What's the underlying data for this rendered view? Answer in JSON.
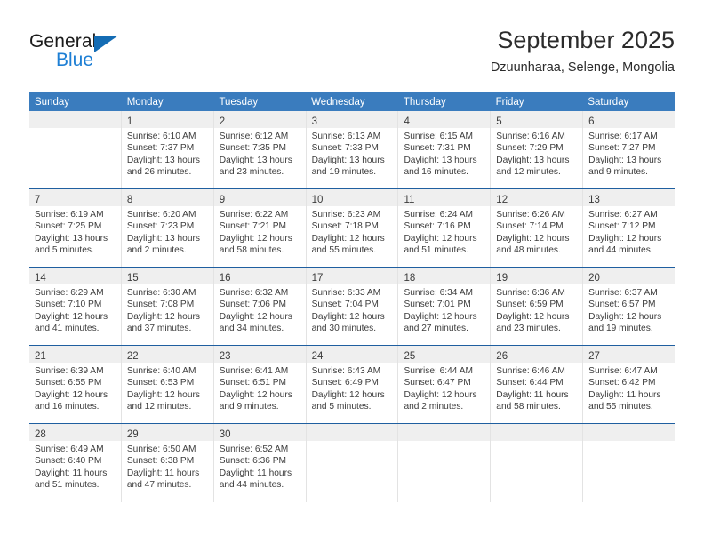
{
  "brand": {
    "name_top": "General",
    "name_bottom": "Blue",
    "triangle_color": "#146cb4",
    "blue_text_color": "#1e7fd4"
  },
  "header": {
    "title": "September 2025",
    "subtitle": "Dzuunharaa, Selenge, Mongolia"
  },
  "theme": {
    "header_bar_color": "#3a7cbe",
    "week_divider_color": "#1f5fa0",
    "daynum_band_color": "#efefef",
    "text_color": "#3c3c3c"
  },
  "weekdays": [
    "Sunday",
    "Monday",
    "Tuesday",
    "Wednesday",
    "Thursday",
    "Friday",
    "Saturday"
  ],
  "weeks": [
    [
      {
        "day": "",
        "sunrise": "",
        "sunset": "",
        "daylight_line1": "",
        "daylight_line2": ""
      },
      {
        "day": "1",
        "sunrise": "Sunrise: 6:10 AM",
        "sunset": "Sunset: 7:37 PM",
        "daylight_line1": "Daylight: 13 hours",
        "daylight_line2": "and 26 minutes."
      },
      {
        "day": "2",
        "sunrise": "Sunrise: 6:12 AM",
        "sunset": "Sunset: 7:35 PM",
        "daylight_line1": "Daylight: 13 hours",
        "daylight_line2": "and 23 minutes."
      },
      {
        "day": "3",
        "sunrise": "Sunrise: 6:13 AM",
        "sunset": "Sunset: 7:33 PM",
        "daylight_line1": "Daylight: 13 hours",
        "daylight_line2": "and 19 minutes."
      },
      {
        "day": "4",
        "sunrise": "Sunrise: 6:15 AM",
        "sunset": "Sunset: 7:31 PM",
        "daylight_line1": "Daylight: 13 hours",
        "daylight_line2": "and 16 minutes."
      },
      {
        "day": "5",
        "sunrise": "Sunrise: 6:16 AM",
        "sunset": "Sunset: 7:29 PM",
        "daylight_line1": "Daylight: 13 hours",
        "daylight_line2": "and 12 minutes."
      },
      {
        "day": "6",
        "sunrise": "Sunrise: 6:17 AM",
        "sunset": "Sunset: 7:27 PM",
        "daylight_line1": "Daylight: 13 hours",
        "daylight_line2": "and 9 minutes."
      }
    ],
    [
      {
        "day": "7",
        "sunrise": "Sunrise: 6:19 AM",
        "sunset": "Sunset: 7:25 PM",
        "daylight_line1": "Daylight: 13 hours",
        "daylight_line2": "and 5 minutes."
      },
      {
        "day": "8",
        "sunrise": "Sunrise: 6:20 AM",
        "sunset": "Sunset: 7:23 PM",
        "daylight_line1": "Daylight: 13 hours",
        "daylight_line2": "and 2 minutes."
      },
      {
        "day": "9",
        "sunrise": "Sunrise: 6:22 AM",
        "sunset": "Sunset: 7:21 PM",
        "daylight_line1": "Daylight: 12 hours",
        "daylight_line2": "and 58 minutes."
      },
      {
        "day": "10",
        "sunrise": "Sunrise: 6:23 AM",
        "sunset": "Sunset: 7:18 PM",
        "daylight_line1": "Daylight: 12 hours",
        "daylight_line2": "and 55 minutes."
      },
      {
        "day": "11",
        "sunrise": "Sunrise: 6:24 AM",
        "sunset": "Sunset: 7:16 PM",
        "daylight_line1": "Daylight: 12 hours",
        "daylight_line2": "and 51 minutes."
      },
      {
        "day": "12",
        "sunrise": "Sunrise: 6:26 AM",
        "sunset": "Sunset: 7:14 PM",
        "daylight_line1": "Daylight: 12 hours",
        "daylight_line2": "and 48 minutes."
      },
      {
        "day": "13",
        "sunrise": "Sunrise: 6:27 AM",
        "sunset": "Sunset: 7:12 PM",
        "daylight_line1": "Daylight: 12 hours",
        "daylight_line2": "and 44 minutes."
      }
    ],
    [
      {
        "day": "14",
        "sunrise": "Sunrise: 6:29 AM",
        "sunset": "Sunset: 7:10 PM",
        "daylight_line1": "Daylight: 12 hours",
        "daylight_line2": "and 41 minutes."
      },
      {
        "day": "15",
        "sunrise": "Sunrise: 6:30 AM",
        "sunset": "Sunset: 7:08 PM",
        "daylight_line1": "Daylight: 12 hours",
        "daylight_line2": "and 37 minutes."
      },
      {
        "day": "16",
        "sunrise": "Sunrise: 6:32 AM",
        "sunset": "Sunset: 7:06 PM",
        "daylight_line1": "Daylight: 12 hours",
        "daylight_line2": "and 34 minutes."
      },
      {
        "day": "17",
        "sunrise": "Sunrise: 6:33 AM",
        "sunset": "Sunset: 7:04 PM",
        "daylight_line1": "Daylight: 12 hours",
        "daylight_line2": "and 30 minutes."
      },
      {
        "day": "18",
        "sunrise": "Sunrise: 6:34 AM",
        "sunset": "Sunset: 7:01 PM",
        "daylight_line1": "Daylight: 12 hours",
        "daylight_line2": "and 27 minutes."
      },
      {
        "day": "19",
        "sunrise": "Sunrise: 6:36 AM",
        "sunset": "Sunset: 6:59 PM",
        "daylight_line1": "Daylight: 12 hours",
        "daylight_line2": "and 23 minutes."
      },
      {
        "day": "20",
        "sunrise": "Sunrise: 6:37 AM",
        "sunset": "Sunset: 6:57 PM",
        "daylight_line1": "Daylight: 12 hours",
        "daylight_line2": "and 19 minutes."
      }
    ],
    [
      {
        "day": "21",
        "sunrise": "Sunrise: 6:39 AM",
        "sunset": "Sunset: 6:55 PM",
        "daylight_line1": "Daylight: 12 hours",
        "daylight_line2": "and 16 minutes."
      },
      {
        "day": "22",
        "sunrise": "Sunrise: 6:40 AM",
        "sunset": "Sunset: 6:53 PM",
        "daylight_line1": "Daylight: 12 hours",
        "daylight_line2": "and 12 minutes."
      },
      {
        "day": "23",
        "sunrise": "Sunrise: 6:41 AM",
        "sunset": "Sunset: 6:51 PM",
        "daylight_line1": "Daylight: 12 hours",
        "daylight_line2": "and 9 minutes."
      },
      {
        "day": "24",
        "sunrise": "Sunrise: 6:43 AM",
        "sunset": "Sunset: 6:49 PM",
        "daylight_line1": "Daylight: 12 hours",
        "daylight_line2": "and 5 minutes."
      },
      {
        "day": "25",
        "sunrise": "Sunrise: 6:44 AM",
        "sunset": "Sunset: 6:47 PM",
        "daylight_line1": "Daylight: 12 hours",
        "daylight_line2": "and 2 minutes."
      },
      {
        "day": "26",
        "sunrise": "Sunrise: 6:46 AM",
        "sunset": "Sunset: 6:44 PM",
        "daylight_line1": "Daylight: 11 hours",
        "daylight_line2": "and 58 minutes."
      },
      {
        "day": "27",
        "sunrise": "Sunrise: 6:47 AM",
        "sunset": "Sunset: 6:42 PM",
        "daylight_line1": "Daylight: 11 hours",
        "daylight_line2": "and 55 minutes."
      }
    ],
    [
      {
        "day": "28",
        "sunrise": "Sunrise: 6:49 AM",
        "sunset": "Sunset: 6:40 PM",
        "daylight_line1": "Daylight: 11 hours",
        "daylight_line2": "and 51 minutes."
      },
      {
        "day": "29",
        "sunrise": "Sunrise: 6:50 AM",
        "sunset": "Sunset: 6:38 PM",
        "daylight_line1": "Daylight: 11 hours",
        "daylight_line2": "and 47 minutes."
      },
      {
        "day": "30",
        "sunrise": "Sunrise: 6:52 AM",
        "sunset": "Sunset: 6:36 PM",
        "daylight_line1": "Daylight: 11 hours",
        "daylight_line2": "and 44 minutes."
      },
      {
        "day": "",
        "sunrise": "",
        "sunset": "",
        "daylight_line1": "",
        "daylight_line2": ""
      },
      {
        "day": "",
        "sunrise": "",
        "sunset": "",
        "daylight_line1": "",
        "daylight_line2": ""
      },
      {
        "day": "",
        "sunrise": "",
        "sunset": "",
        "daylight_line1": "",
        "daylight_line2": ""
      },
      {
        "day": "",
        "sunrise": "",
        "sunset": "",
        "daylight_line1": "",
        "daylight_line2": ""
      }
    ]
  ]
}
